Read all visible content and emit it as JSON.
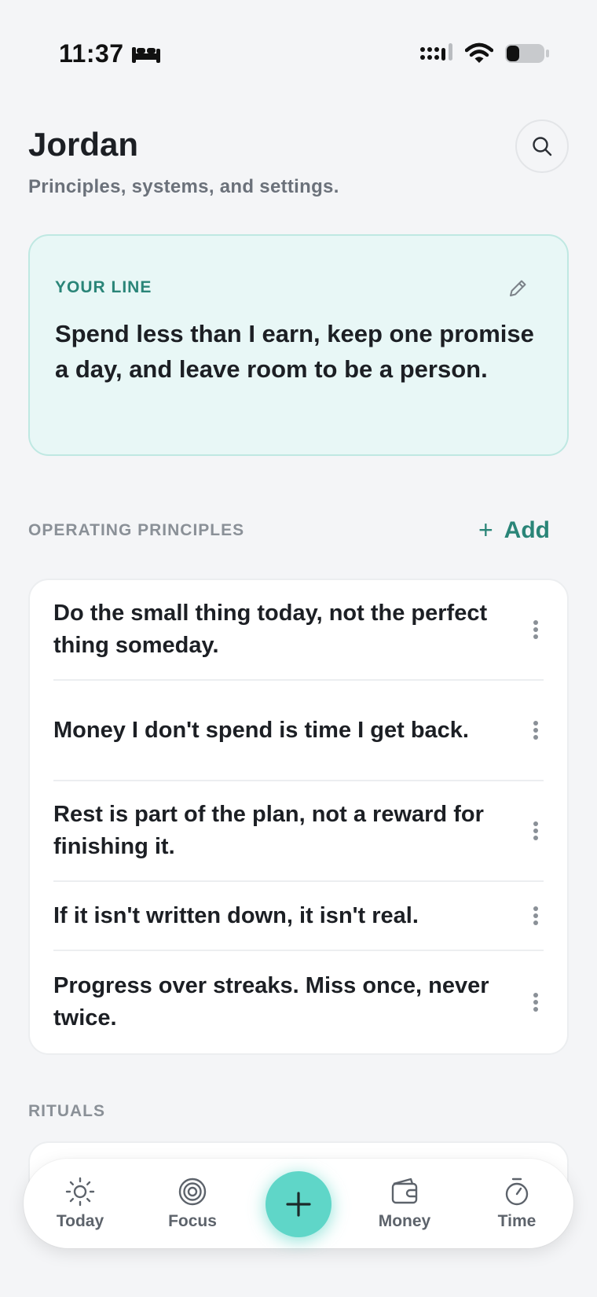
{
  "status_bar": {
    "time": "11:37",
    "icons": [
      "bed-icon",
      "signal-icon",
      "wifi-icon",
      "battery-icon"
    ]
  },
  "header": {
    "title": "Jordan",
    "subtitle": "Principles, systems, and settings.",
    "search_icon": "search-icon"
  },
  "your_line": {
    "label": "YOUR LINE",
    "text": "Spend less than I earn, keep one promise a day, and leave room to be a person.",
    "edit_icon": "pencil-icon"
  },
  "principles": {
    "label": "OPERATING PRINCIPLES",
    "add_label": "Add",
    "items": [
      "Do the small thing today, not the perfect thing someday.",
      "Money I don't spend is time I get back.",
      "Rest is part of the plan, not a reward for finishing it.",
      "If it isn't written down, it isn't real.",
      "Progress over streaks. Miss once, never twice."
    ]
  },
  "rituals": {
    "label": "RITUALS"
  },
  "nav": {
    "items": [
      {
        "label": "Today",
        "icon": "sun-icon"
      },
      {
        "label": "Focus",
        "icon": "target-icon"
      },
      {
        "label": "Money",
        "icon": "wallet-icon"
      },
      {
        "label": "Time",
        "icon": "stopwatch-icon"
      }
    ],
    "fab_icon": "plus-icon"
  },
  "colors": {
    "accent": "#2a8578",
    "fab": "#5fd6c8",
    "card_tint": "#e8f7f6",
    "background": "#f4f5f7"
  }
}
